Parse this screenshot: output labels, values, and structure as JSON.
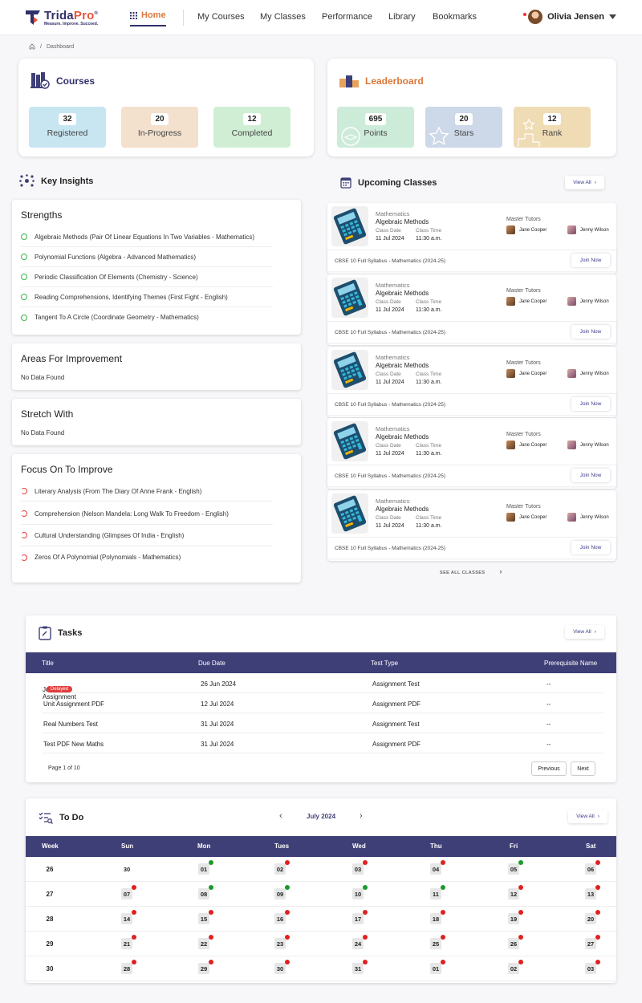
{
  "brand": {
    "name_a": "Trida",
    "name_b": "Pro",
    "reg": "®",
    "tagline": "Measure. Improve. Succeed."
  },
  "nav": {
    "home": "Home",
    "items": [
      "My Courses",
      "My Classes",
      "Performance",
      "Library",
      "Bookmarks"
    ],
    "user": "Olivia Jensen"
  },
  "breadcrumb": {
    "current": "Dashboard"
  },
  "courses": {
    "title": "Courses",
    "stats": [
      {
        "value": "32",
        "label": "Registered",
        "color": "#c8e6f2"
      },
      {
        "value": "20",
        "label": "In-Progress",
        "color": "#f3e0cd"
      },
      {
        "value": "12",
        "label": "Completed",
        "color": "#cfeed3"
      }
    ]
  },
  "leaderboard": {
    "title": "Leaderboard",
    "stats": [
      {
        "value": "695",
        "label": "Points",
        "color": "#cdebd9"
      },
      {
        "value": "20",
        "label": "Stars",
        "color": "#cdd8e8"
      },
      {
        "value": "12",
        "label": "Rank",
        "color": "#efdcb4"
      }
    ]
  },
  "insights": {
    "title": "Key Insights",
    "strengths": {
      "title": "Strengths",
      "items": [
        "Algebraic Methods (Pair Of Linear Equations In Two Variables - Mathematics)",
        "Polynomial Functions (Algebra - Advanced Mathematics)",
        "Periodic Classification Of Elements (Chemistry - Science)",
        "Reading Comprehensions, Identifying Themes (First Fight - English)",
        "Tangent To A Circle (Coordinate Geometry - Mathematics)"
      ]
    },
    "improvement": {
      "title": "Areas For Improvement",
      "empty": "No Data Found"
    },
    "stretch": {
      "title": "Stretch With",
      "empty": "No Data Found"
    },
    "focus": {
      "title": "Focus On To Improve",
      "items": [
        "Literary Analysis (From The Diary Of Anne Frank - English)",
        "Comprehension (Nelson Mandela: Long Walk To Freedom - English)",
        "Cultural Understanding (Glimpses Of India - English)",
        "Zeros Of A Polynomial (Polynomials - Mathematics)"
      ]
    }
  },
  "upcoming": {
    "title": "Upcoming Classes",
    "view_all": "View All",
    "see_all": "SEE ALL CLASSES",
    "labels": {
      "date": "Class Date",
      "time": "Class Time",
      "tutors": "Master Tutors",
      "join": "Join Now"
    },
    "classes": [
      {
        "subject": "Mathematics",
        "name": "Algebraic Methods",
        "date": "11 Jul 2024",
        "time": "11:30 a.m.",
        "tutor1": "Jane Cooper",
        "tutor2": "Jenny Wilson",
        "syllabus": "CBSE 10 Full Syllabus - Mathematics (2024-25)"
      },
      {
        "subject": "Mathematics",
        "name": "Algebraic Methods",
        "date": "11 Jul 2024",
        "time": "11:30 a.m.",
        "tutor1": "Jane Cooper",
        "tutor2": "Jenny Wilson",
        "syllabus": "CBSE 10 Full Syllabus - Mathematics (2024-25)"
      },
      {
        "subject": "Mathematics",
        "name": "Algebraic Methods",
        "date": "11 Jul 2024",
        "time": "11:30 a.m.",
        "tutor1": "Jane Cooper",
        "tutor2": "Jenny Wilson",
        "syllabus": "CBSE 10 Full Syllabus - Mathematics (2024-25)"
      },
      {
        "subject": "Mathematics",
        "name": "Algebraic Methods",
        "date": "11 Jul 2024",
        "time": "11:30 a.m.",
        "tutor1": "Jane Cooper",
        "tutor2": "Jenny Wilson",
        "syllabus": "CBSE 10 Full Syllabus - Mathematics (2024-25)"
      },
      {
        "subject": "Mathematics",
        "name": "Algebraic Methods",
        "date": "11 Jul 2024",
        "time": "11:30 a.m.",
        "tutor1": "Jane Cooper",
        "tutor2": "Jenny Wilson",
        "syllabus": "CBSE 10 Full Syllabus - Mathematics (2024-25)"
      }
    ]
  },
  "tasks": {
    "title": "Tasks",
    "view_all": "View All",
    "columns": [
      "Title",
      "Due Date",
      "Test Type",
      "Prerequisite Name"
    ],
    "rows": [
      {
        "title": "June 21 Assignment",
        "badge": "Delayed",
        "due": "26 Jun 2024",
        "type": "Assignment Test",
        "prereq": "--"
      },
      {
        "title": "Unit Assignment PDF",
        "badge": "",
        "due": "12 Jul 2024",
        "type": "Assignment PDF",
        "prereq": "--"
      },
      {
        "title": "Real Numbers Test",
        "badge": "",
        "due": "31 Jul 2024",
        "type": "Assignment Test",
        "prereq": "--"
      },
      {
        "title": "Test PDF New Maths",
        "badge": "",
        "due": "31 Jul 2024",
        "type": "Assignment PDF",
        "prereq": "--"
      }
    ],
    "page_info": "Page 1 of 10",
    "prev": "Previous",
    "next": "Next"
  },
  "todo": {
    "title": "To Do",
    "month": "July 2024",
    "view_all": "View All",
    "columns": [
      "Week",
      "Sun",
      "Mon",
      "Tues",
      "Wed",
      "Thu",
      "Fri",
      "Sat"
    ],
    "weeks": [
      {
        "week": "26",
        "days": [
          {
            "d": "30",
            "s": ""
          },
          {
            "d": "01",
            "s": "g"
          },
          {
            "d": "02",
            "s": "r"
          },
          {
            "d": "03",
            "s": "r"
          },
          {
            "d": "04",
            "s": "r"
          },
          {
            "d": "05",
            "s": "g"
          },
          {
            "d": "06",
            "s": "r"
          }
        ]
      },
      {
        "week": "27",
        "days": [
          {
            "d": "07",
            "s": "r"
          },
          {
            "d": "08",
            "s": "g"
          },
          {
            "d": "09",
            "s": "g"
          },
          {
            "d": "10",
            "s": "g"
          },
          {
            "d": "11",
            "s": "g"
          },
          {
            "d": "12",
            "s": "r"
          },
          {
            "d": "13",
            "s": "r"
          }
        ]
      },
      {
        "week": "28",
        "days": [
          {
            "d": "14",
            "s": "r"
          },
          {
            "d": "15",
            "s": "r"
          },
          {
            "d": "16",
            "s": "r"
          },
          {
            "d": "17",
            "s": "r"
          },
          {
            "d": "18",
            "s": "r"
          },
          {
            "d": "19",
            "s": "r"
          },
          {
            "d": "20",
            "s": "r"
          }
        ]
      },
      {
        "week": "29",
        "days": [
          {
            "d": "21",
            "s": "r"
          },
          {
            "d": "22",
            "s": "r"
          },
          {
            "d": "23",
            "s": "r"
          },
          {
            "d": "24",
            "s": "r"
          },
          {
            "d": "25",
            "s": "r"
          },
          {
            "d": "26",
            "s": "r"
          },
          {
            "d": "27",
            "s": "r"
          }
        ]
      },
      {
        "week": "30",
        "days": [
          {
            "d": "28",
            "s": "r"
          },
          {
            "d": "29",
            "s": "r"
          },
          {
            "d": "30",
            "s": "r"
          },
          {
            "d": "31",
            "s": "r"
          },
          {
            "d": "01",
            "s": "r"
          },
          {
            "d": "02",
            "s": "r"
          },
          {
            "d": "03",
            "s": "r"
          }
        ]
      }
    ]
  }
}
